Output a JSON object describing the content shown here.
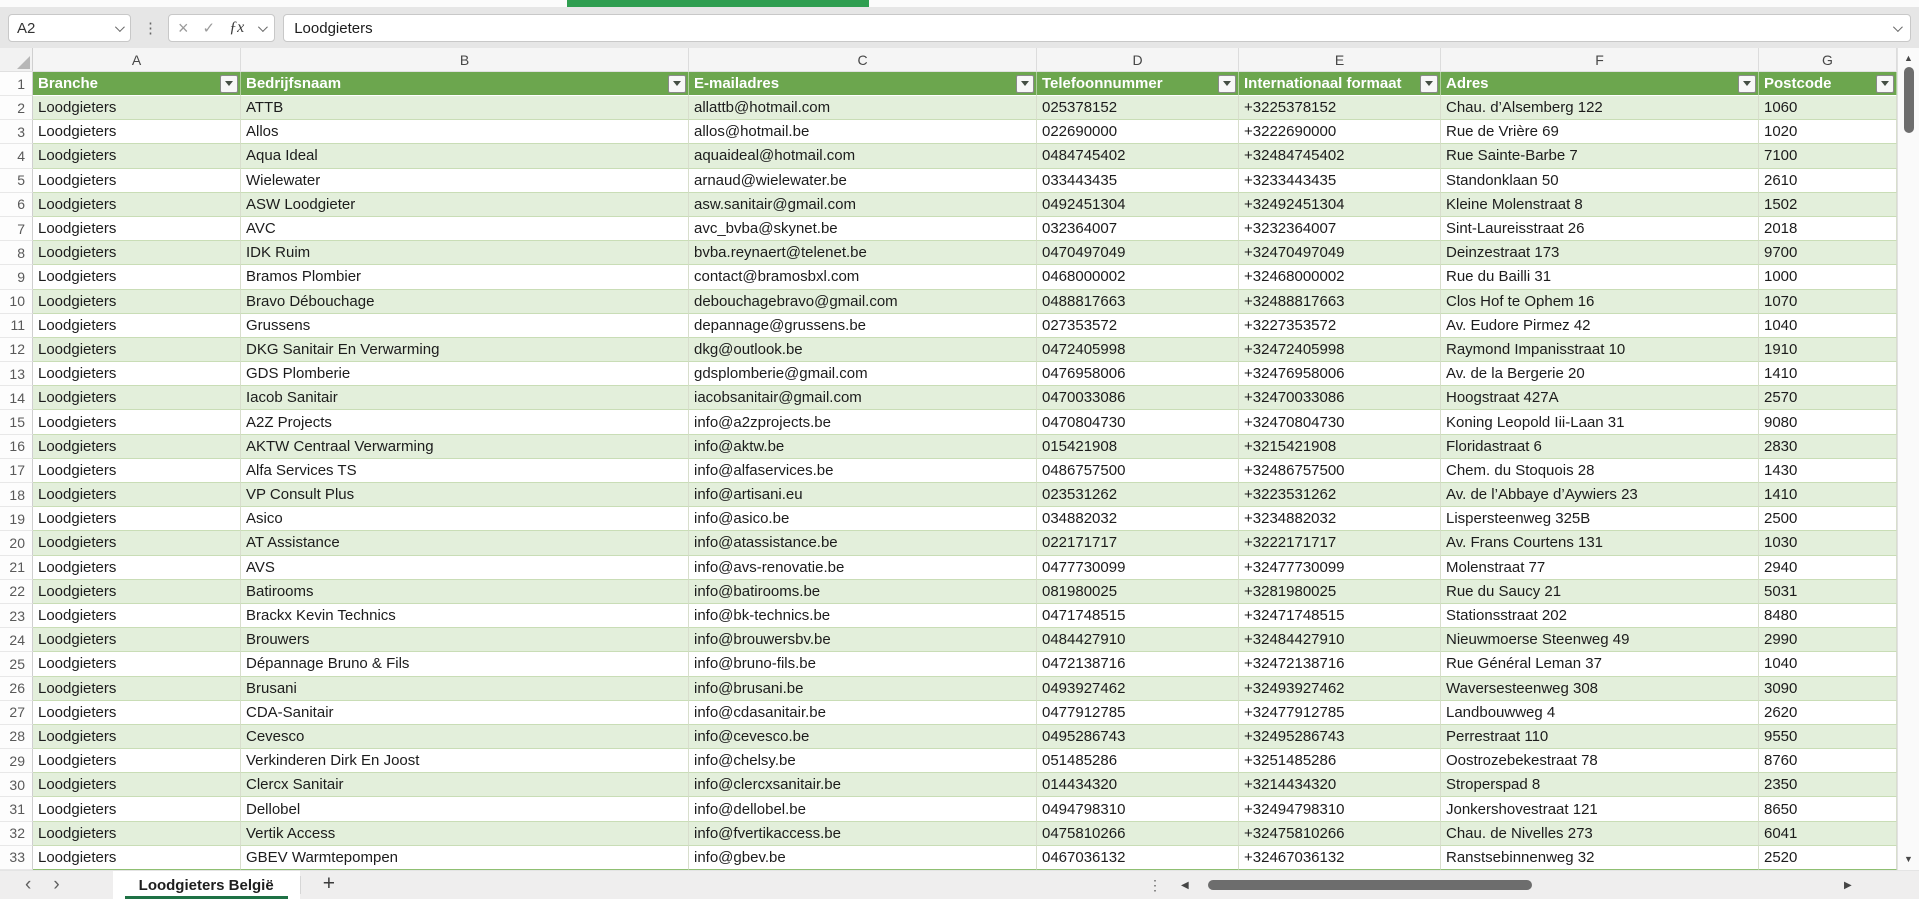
{
  "formula_bar": {
    "name_box": "A2",
    "formula": "Loodgieters"
  },
  "icons": {
    "cancel": "×",
    "enter": "✓",
    "fx": "ƒx",
    "dots": "⋮",
    "prev": "‹",
    "next": "›",
    "add": "+",
    "up": "▲",
    "down": "▼",
    "left": "◀",
    "right": "▶"
  },
  "colors": {
    "header_green": "#6ca64e",
    "band_green": "#e3efdb",
    "tab_underline_green": "#1e7145",
    "accent_green": "#2f9e50"
  },
  "columns": [
    "A",
    "B",
    "C",
    "D",
    "E",
    "F",
    "G"
  ],
  "table": {
    "header_row_number": "1",
    "headers": [
      "Branche",
      "Bedrijfsnaam",
      "E-mailadres",
      "Telefoonnummer",
      "Internationaal formaat",
      "Adres",
      "Postcode"
    ],
    "rows": [
      {
        "n": "2",
        "cells": [
          "Loodgieters",
          "ATTB",
          "allattb@hotmail.com",
          "025378152",
          "+3225378152",
          "Chau. d’Alsemberg 122",
          "1060"
        ]
      },
      {
        "n": "3",
        "cells": [
          "Loodgieters",
          "Allos",
          "allos@hotmail.be",
          "022690000",
          "+3222690000",
          "Rue de Vrière 69",
          "1020"
        ]
      },
      {
        "n": "4",
        "cells": [
          "Loodgieters",
          "Aqua Ideal",
          "aquaideal@hotmail.com",
          "0484745402",
          "+32484745402",
          "Rue Sainte-Barbe 7",
          "7100"
        ]
      },
      {
        "n": "5",
        "cells": [
          "Loodgieters",
          "Wielewater",
          "arnaud@wielewater.be",
          "033443435",
          "+3233443435",
          "Standonklaan 50",
          "2610"
        ]
      },
      {
        "n": "6",
        "cells": [
          "Loodgieters",
          "ASW Loodgieter",
          "asw.sanitair@gmail.com",
          "0492451304",
          "+32492451304",
          "Kleine Molenstraat 8",
          "1502"
        ]
      },
      {
        "n": "7",
        "cells": [
          "Loodgieters",
          "AVC",
          "avc_bvba@skynet.be",
          "032364007",
          "+3232364007",
          "Sint-Laureisstraat 26",
          "2018"
        ]
      },
      {
        "n": "8",
        "cells": [
          "Loodgieters",
          "IDK Ruim",
          "bvba.reynaert@telenet.be",
          "0470497049",
          "+32470497049",
          "Deinzestraat 173",
          "9700"
        ]
      },
      {
        "n": "9",
        "cells": [
          "Loodgieters",
          "Bramos Plombier",
          "contact@bramosbxl.com",
          "0468000002",
          "+32468000002",
          "Rue du Bailli 31",
          "1000"
        ]
      },
      {
        "n": "10",
        "cells": [
          "Loodgieters",
          "Bravo Débouchage",
          "debouchagebravo@gmail.com",
          "0488817663",
          "+32488817663",
          "Clos Hof te Ophem 16",
          "1070"
        ]
      },
      {
        "n": "11",
        "cells": [
          "Loodgieters",
          "Grussens",
          "depannage@grussens.be",
          "027353572",
          "+3227353572",
          "Av. Eudore Pirmez 42",
          "1040"
        ]
      },
      {
        "n": "12",
        "cells": [
          "Loodgieters",
          "DKG Sanitair En Verwarming",
          "dkg@outlook.be",
          "0472405998",
          "+32472405998",
          "Raymond Impanisstraat 10",
          "1910"
        ]
      },
      {
        "n": "13",
        "cells": [
          "Loodgieters",
          "GDS Plomberie",
          "gdsplomberie@gmail.com",
          "0476958006",
          "+32476958006",
          "Av. de la Bergerie 20",
          "1410"
        ]
      },
      {
        "n": "14",
        "cells": [
          "Loodgieters",
          "Iacob Sanitair",
          "iacobsanitair@gmail.com",
          "0470033086",
          "+32470033086",
          "Hoogstraat 427A",
          "2570"
        ]
      },
      {
        "n": "15",
        "cells": [
          "Loodgieters",
          "A2Z Projects",
          "info@a2zprojects.be",
          "0470804730",
          "+32470804730",
          "Koning Leopold Iii-Laan 31",
          "9080"
        ]
      },
      {
        "n": "16",
        "cells": [
          "Loodgieters",
          "AKTW Centraal Verwarming",
          "info@aktw.be",
          "015421908",
          "+3215421908",
          "Floridastraat 6",
          "2830"
        ]
      },
      {
        "n": "17",
        "cells": [
          "Loodgieters",
          "Alfa Services TS",
          "info@alfaservices.be",
          "0486757500",
          "+32486757500",
          "Chem. du Stoquois 28",
          "1430"
        ]
      },
      {
        "n": "18",
        "cells": [
          "Loodgieters",
          "VP Consult Plus",
          "info@artisani.eu",
          "023531262",
          "+3223531262",
          "Av. de l’Abbaye d’Aywiers 23",
          "1410"
        ]
      },
      {
        "n": "19",
        "cells": [
          "Loodgieters",
          "Asico",
          "info@asico.be",
          "034882032",
          "+3234882032",
          "Lispersteenweg 325B",
          "2500"
        ]
      },
      {
        "n": "20",
        "cells": [
          "Loodgieters",
          "AT Assistance",
          "info@atassistance.be",
          "022171717",
          "+3222171717",
          "Av. Frans Courtens 131",
          "1030"
        ]
      },
      {
        "n": "21",
        "cells": [
          "Loodgieters",
          "AVS",
          "info@avs-renovatie.be",
          "0477730099",
          "+32477730099",
          "Molenstraat 77",
          "2940"
        ]
      },
      {
        "n": "22",
        "cells": [
          "Loodgieters",
          "Batirooms",
          "info@batirooms.be",
          "081980025",
          "+3281980025",
          "Rue du Saucy 21",
          "5031"
        ]
      },
      {
        "n": "23",
        "cells": [
          "Loodgieters",
          "Brackx Kevin Technics",
          "info@bk-technics.be",
          "0471748515",
          "+32471748515",
          "Stationsstraat 202",
          "8480"
        ]
      },
      {
        "n": "24",
        "cells": [
          "Loodgieters",
          "Brouwers",
          "info@brouwersbv.be",
          "0484427910",
          "+32484427910",
          "Nieuwmoerse Steenweg 49",
          "2990"
        ]
      },
      {
        "n": "25",
        "cells": [
          "Loodgieters",
          "Dépannage Bruno & Fils",
          "info@bruno-fils.be",
          "0472138716",
          "+32472138716",
          "Rue Général Leman 37",
          "1040"
        ]
      },
      {
        "n": "26",
        "cells": [
          "Loodgieters",
          "Brusani",
          "info@brusani.be",
          "0493927462",
          "+32493927462",
          "Waversesteenweg 308",
          "3090"
        ]
      },
      {
        "n": "27",
        "cells": [
          "Loodgieters",
          "CDA-Sanitair",
          "info@cdasanitair.be",
          "0477912785",
          "+32477912785",
          "Landbouwweg 4",
          "2620"
        ]
      },
      {
        "n": "28",
        "cells": [
          "Loodgieters",
          "Cevesco",
          "info@cevesco.be",
          "0495286743",
          "+32495286743",
          "Perrestraat 110",
          "9550"
        ]
      },
      {
        "n": "29",
        "cells": [
          "Loodgieters",
          "Verkinderen Dirk En Joost",
          "info@chelsy.be",
          "051485286",
          "+3251485286",
          "Oostrozebekestraat 78",
          "8760"
        ]
      },
      {
        "n": "30",
        "cells": [
          "Loodgieters",
          "Clercx Sanitair",
          "info@clercxsanitair.be",
          "014434320",
          "+3214434320",
          "Stroperspad 8",
          "2350"
        ]
      },
      {
        "n": "31",
        "cells": [
          "Loodgieters",
          "Dellobel",
          "info@dellobel.be",
          "0494798310",
          "+32494798310",
          "Jonkershovestraat 121",
          "8650"
        ]
      },
      {
        "n": "32",
        "cells": [
          "Loodgieters",
          "Vertik Access",
          "info@fvertikaccess.be",
          "0475810266",
          "+32475810266",
          "Chau. de Nivelles 273",
          "6041"
        ]
      },
      {
        "n": "33",
        "cells": [
          "Loodgieters",
          "GBEV Warmtepompen",
          "info@gbev.be",
          "0467036132",
          "+32467036132",
          "Ranstsebinnenweg 32",
          "2520"
        ]
      }
    ]
  },
  "sheet_tabs": {
    "active": "Loodgieters België"
  }
}
